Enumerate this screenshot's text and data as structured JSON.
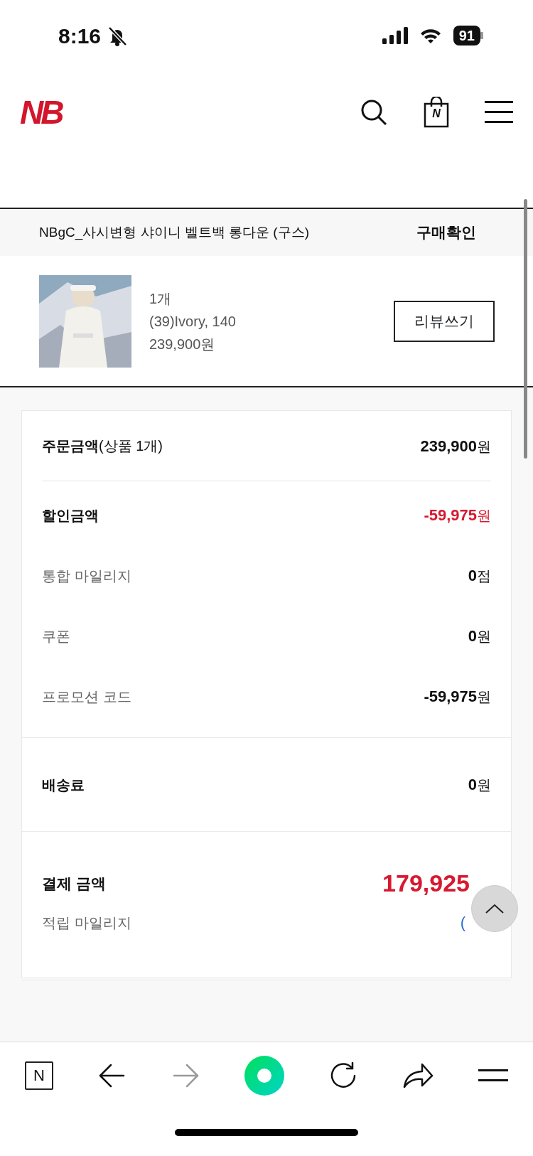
{
  "status_bar": {
    "time": "8:16",
    "battery": "91"
  },
  "header": {
    "logo": "NB",
    "bag_mark": "N"
  },
  "order_item": {
    "product_name": "NBgC_사시변형 샤이니 벨트백 롱다운 (구스)",
    "status": "구매확인",
    "quantity": "1개",
    "option": "(39)Ivory, 140",
    "price": "239,900원",
    "review_button": "리뷰쓰기"
  },
  "summary": {
    "sections": [
      {
        "rows": [
          {
            "kind": "main",
            "label": "주문금액",
            "label_note": "(상품 1개)",
            "amount": "239,900",
            "unit": "원",
            "highlighted": false
          }
        ]
      },
      {
        "rows": [
          {
            "kind": "main",
            "label": "할인금액",
            "amount": "-59,975",
            "unit": "원",
            "highlighted": true
          },
          {
            "kind": "sub",
            "label": "통합 마일리지",
            "amount": "0",
            "unit": "점",
            "highlighted": false
          },
          {
            "kind": "sub",
            "label": "쿠폰",
            "amount": "0",
            "unit": "원",
            "highlighted": false
          },
          {
            "kind": "sub",
            "label": "프로모션 코드",
            "amount": "-59,975",
            "unit": "원",
            "highlighted": false
          }
        ]
      },
      {
        "rows": [
          {
            "kind": "main",
            "label": "배송료",
            "amount": "0",
            "unit": "원",
            "highlighted": false
          }
        ]
      },
      {
        "rows": [
          {
            "kind": "total",
            "label": "결제 금액",
            "amount": "179,925",
            "highlighted": true
          },
          {
            "kind": "sub",
            "label": "적립 마일리지",
            "amount": "(",
            "link": true
          }
        ]
      }
    ]
  },
  "browser_toolbar": {
    "home_mark": "N",
    "back": {
      "disabled": false
    },
    "forward": {
      "disabled": true
    }
  }
}
